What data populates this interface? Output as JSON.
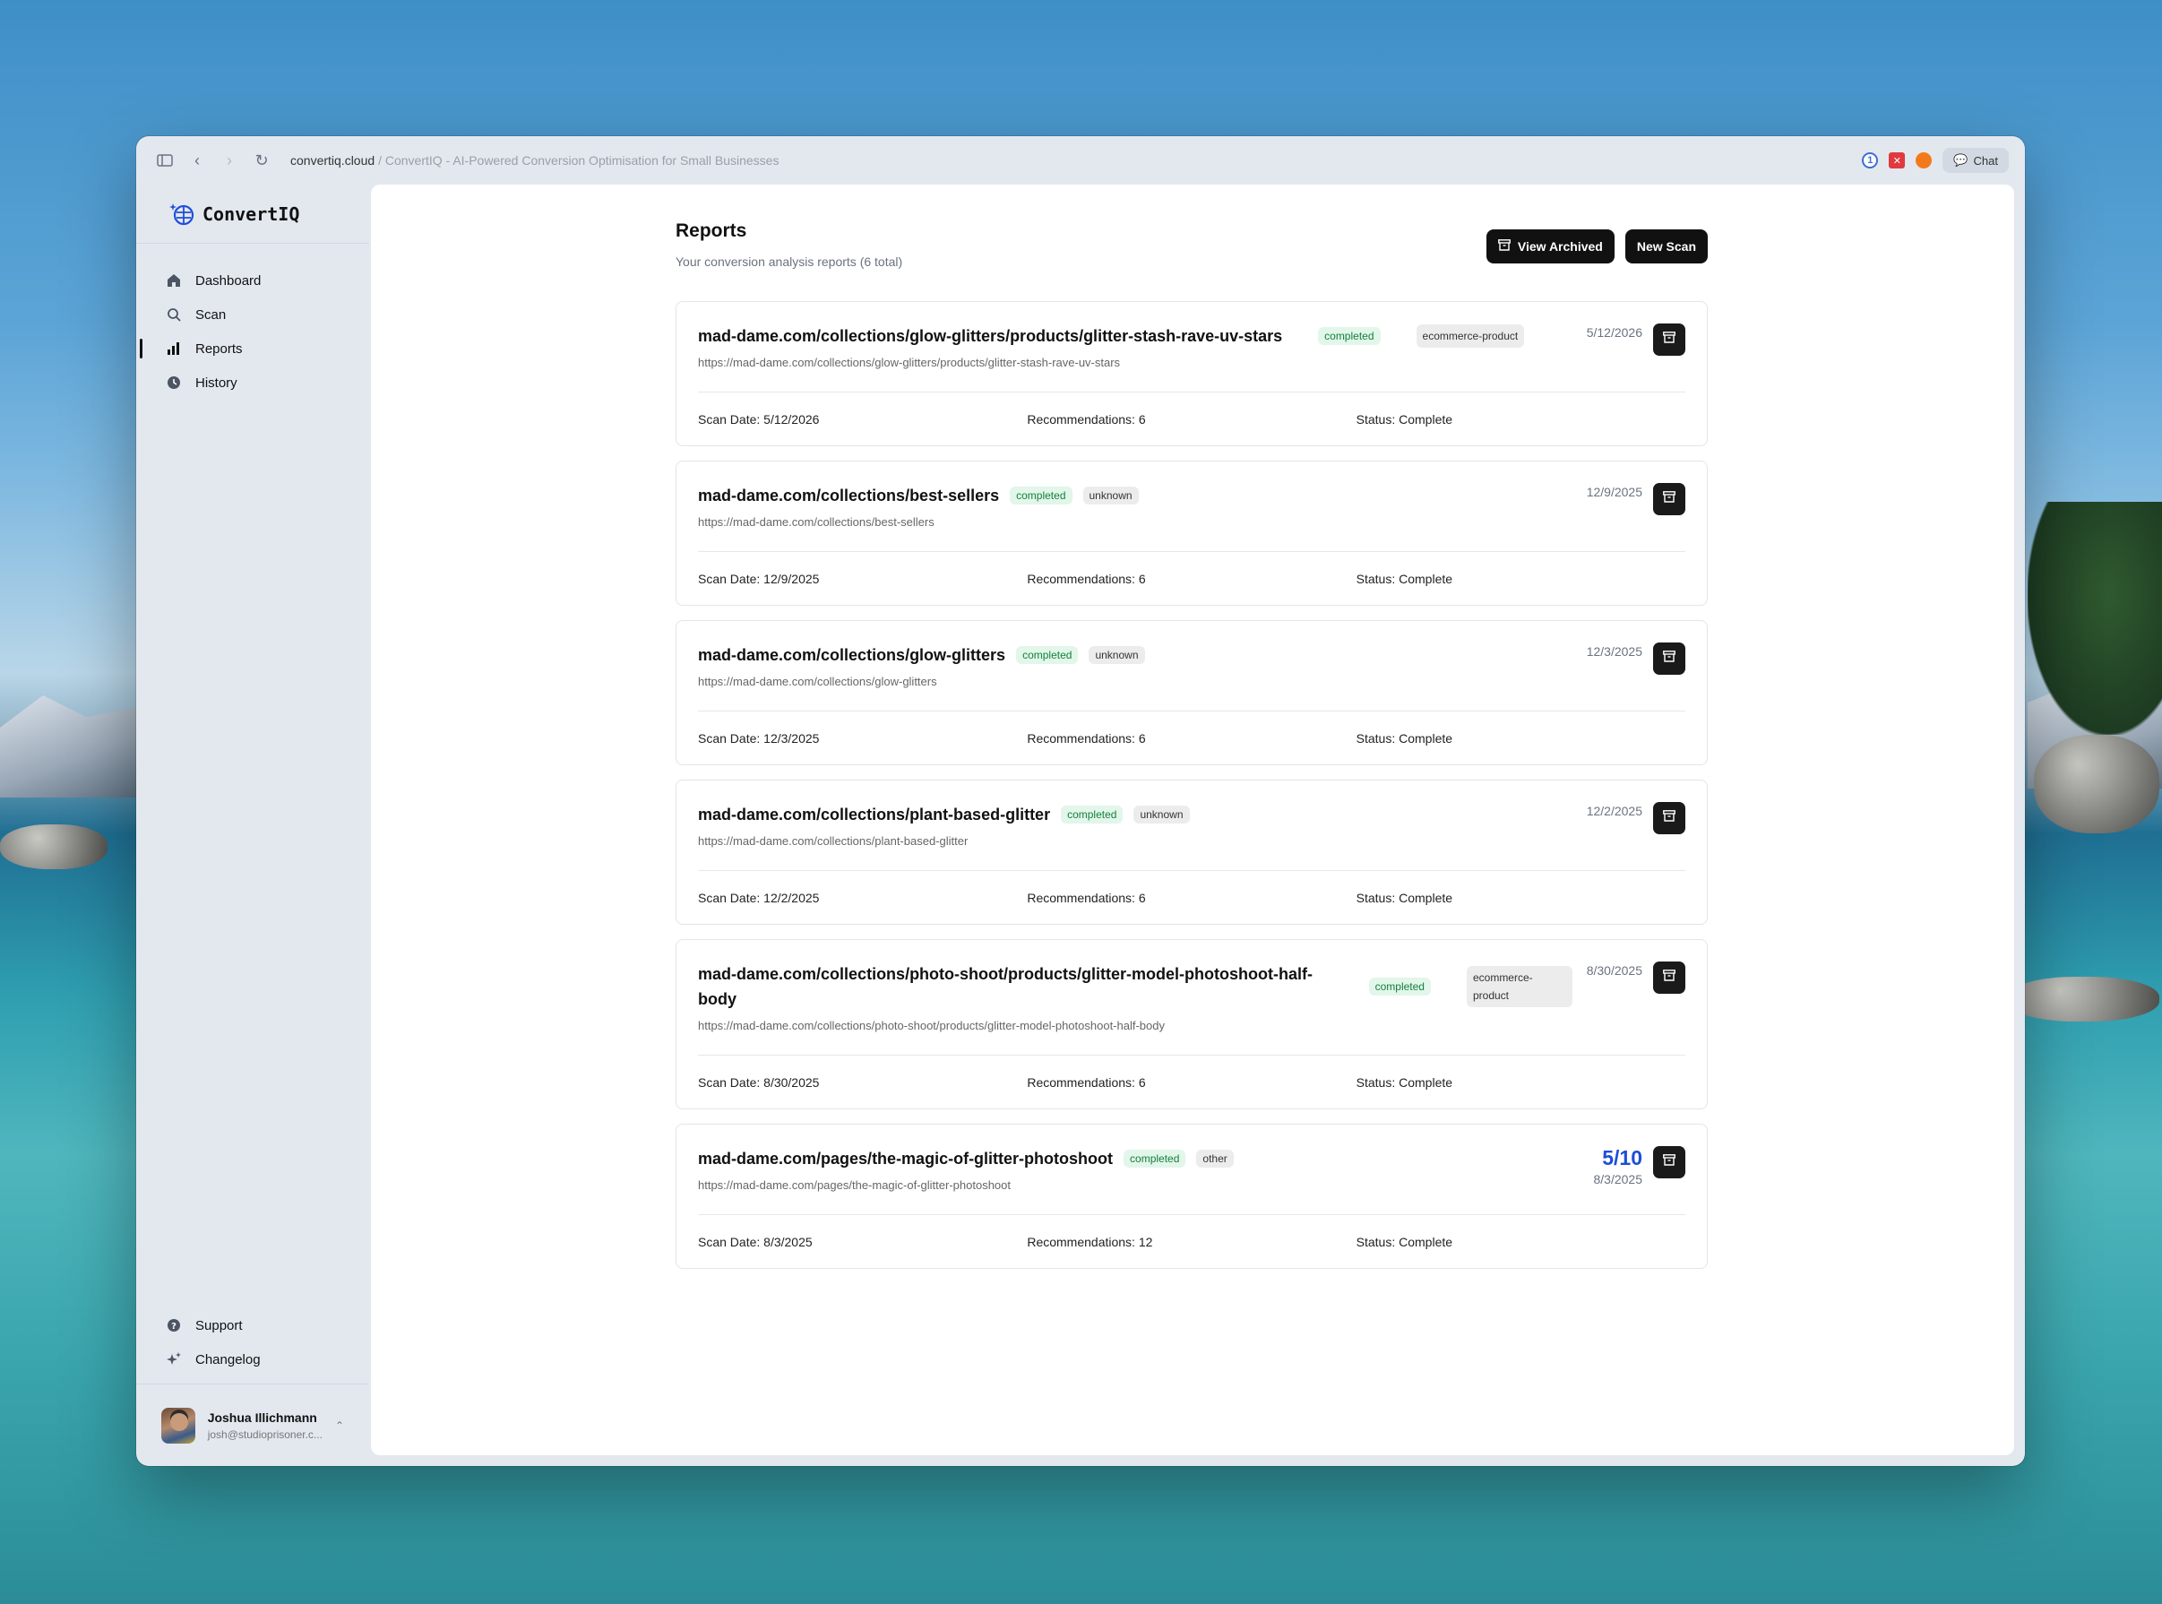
{
  "browser": {
    "host": "convertiq.cloud",
    "separator": "/",
    "page_title": "ConvertIQ - AI-Powered Conversion Optimisation for Small Businesses",
    "chat_label": "Chat"
  },
  "brand": {
    "name": "ConvertIQ"
  },
  "nav": {
    "items": [
      {
        "label": "Dashboard",
        "icon": "home-icon"
      },
      {
        "label": "Scan",
        "icon": "search-icon"
      },
      {
        "label": "Reports",
        "icon": "bar-chart-icon",
        "active": true
      },
      {
        "label": "History",
        "icon": "clock-icon"
      }
    ],
    "bottom": [
      {
        "label": "Support",
        "icon": "help-icon"
      },
      {
        "label": "Changelog",
        "icon": "sparkle-icon"
      }
    ]
  },
  "user": {
    "name": "Joshua Illichmann",
    "email": "josh@studioprisoner.c..."
  },
  "page": {
    "title": "Reports",
    "subtitle": "Your conversion analysis reports (6 total)",
    "view_archived": "View Archived",
    "new_scan": "New Scan"
  },
  "reports": [
    {
      "title": "mad-dame.com/collections/glow-glitters/products/glitter-stash-rave-uv-stars",
      "status_badge": "completed",
      "type_badge": "ecommerce-product",
      "url": "https://mad-dame.com/collections/glow-glitters/products/glitter-stash-rave-uv-stars",
      "date": "5/12/2026",
      "score": "",
      "scan_date": "Scan Date: 5/12/2026",
      "recommendations": "Recommendations: 6",
      "status": "Status: Complete"
    },
    {
      "title": "mad-dame.com/collections/best-sellers",
      "status_badge": "completed",
      "type_badge": "unknown",
      "url": "https://mad-dame.com/collections/best-sellers",
      "date": "12/9/2025",
      "score": "",
      "scan_date": "Scan Date: 12/9/2025",
      "recommendations": "Recommendations: 6",
      "status": "Status: Complete"
    },
    {
      "title": "mad-dame.com/collections/glow-glitters",
      "status_badge": "completed",
      "type_badge": "unknown",
      "url": "https://mad-dame.com/collections/glow-glitters",
      "date": "12/3/2025",
      "score": "",
      "scan_date": "Scan Date: 12/3/2025",
      "recommendations": "Recommendations: 6",
      "status": "Status: Complete"
    },
    {
      "title": "mad-dame.com/collections/plant-based-glitter",
      "status_badge": "completed",
      "type_badge": "unknown",
      "url": "https://mad-dame.com/collections/plant-based-glitter",
      "date": "12/2/2025",
      "score": "",
      "scan_date": "Scan Date: 12/2/2025",
      "recommendations": "Recommendations: 6",
      "status": "Status: Complete"
    },
    {
      "title": "mad-dame.com/collections/photo-shoot/products/glitter-model-photoshoot-half-body",
      "status_badge": "completed",
      "type_badge": "ecommerce-product",
      "url": "https://mad-dame.com/collections/photo-shoot/products/glitter-model-photoshoot-half-body",
      "date": "8/30/2025",
      "score": "",
      "scan_date": "Scan Date: 8/30/2025",
      "recommendations": "Recommendations: 6",
      "status": "Status: Complete"
    },
    {
      "title": "mad-dame.com/pages/the-magic-of-glitter-photoshoot",
      "status_badge": "completed",
      "type_badge": "other",
      "url": "https://mad-dame.com/pages/the-magic-of-glitter-photoshoot",
      "date": "8/3/2025",
      "score": "5/10",
      "scan_date": "Scan Date: 8/3/2025",
      "recommendations": "Recommendations: 12",
      "status": "Status: Complete"
    }
  ],
  "colors": {
    "accent_score": "#1d4ed8",
    "badge_green": "#15803d",
    "button_dark": "#111111"
  }
}
